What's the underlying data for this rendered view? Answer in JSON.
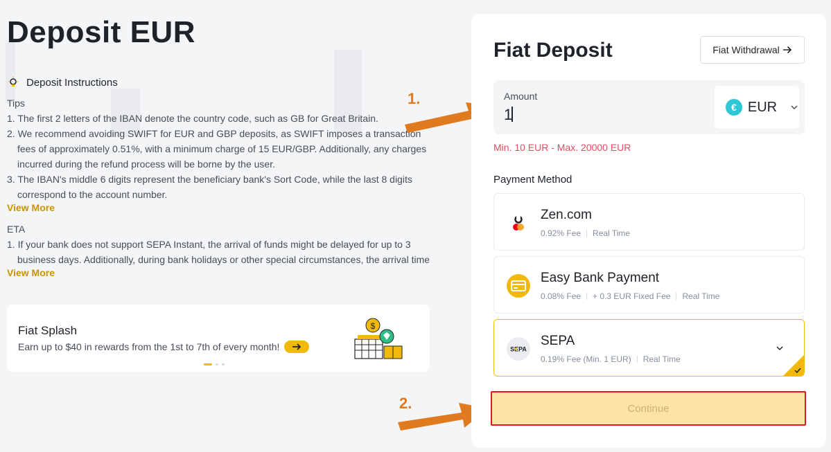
{
  "page": {
    "title": "Deposit EUR",
    "instructions_heading": "Deposit Instructions",
    "tips_label": "Tips",
    "tips": [
      "1. The first 2 letters of the IBAN denote the country code, such as GB for Great Britain.",
      "2. We recommend avoiding SWIFT for EUR and GBP deposits, as SWIFT imposes a transaction fees of approximately 0.51%, with a minimum charge of 15 EUR/GBP. Additionally, any charges incurred during the refund process will be borne by the user.",
      "3. The IBAN's middle 6 digits represent the beneficiary bank's Sort Code, while the last 8 digits correspond to the account number."
    ],
    "view_more_1": "View More",
    "eta_label": "ETA",
    "eta": [
      "1. If your bank does not support SEPA Instant, the arrival of funds might be delayed for up to 3 business days. Additionally, during bank holidays or other special circumstances, the arrival time"
    ],
    "view_more_2": "View More"
  },
  "splash": {
    "title": "Fiat Splash",
    "description": "Earn up to $40 in rewards from the 1st to 7th of every month!",
    "carousel_pages": 3,
    "carousel_active": 1
  },
  "card": {
    "title": "Fiat Deposit",
    "withdraw_label": "Fiat Withdrawal",
    "amount_label": "Amount",
    "amount_value": "1",
    "currency": {
      "code": "EUR",
      "symbol": "€",
      "icon": "euro-icon"
    },
    "limit_text": "Min. 10 EUR - Max. 20000 EUR",
    "payment_method_label": "Payment Method",
    "methods": [
      {
        "name": "Zen.com",
        "fee": "0.92% Fee",
        "extra": "",
        "speed": "Real Time",
        "icon": "zen-icon"
      },
      {
        "name": "Easy Bank Payment",
        "fee": "0.08% Fee",
        "extra": "+ 0.3 EUR Fixed Fee",
        "speed": "Real Time",
        "icon": "card-icon"
      },
      {
        "name": "SEPA",
        "fee": "0.19% Fee (Min. 1 EUR)",
        "extra": "",
        "speed": "Real Time",
        "icon": "sepa-icon",
        "selected": true
      }
    ],
    "continue_label": "Continue"
  },
  "annotations": {
    "step1": "1.",
    "step2": "2."
  },
  "colors": {
    "accent": "#f0b90b",
    "error": "#e84a5f",
    "annotation": "#e07a1f",
    "highlight_border": "#e01a1a"
  }
}
